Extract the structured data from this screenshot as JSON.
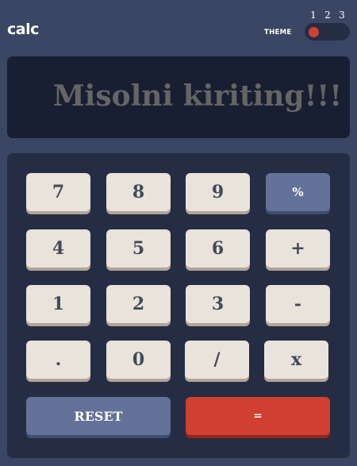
{
  "header": {
    "logo": "calc",
    "theme_label": "THEME",
    "theme_numbers": [
      "1",
      "2",
      "3"
    ]
  },
  "screen": {
    "value": "Misolni kiriting!!!"
  },
  "keys": {
    "row1": [
      "7",
      "8",
      "9",
      "%"
    ],
    "row2": [
      "4",
      "5",
      "6",
      "+"
    ],
    "row3": [
      "1",
      "2",
      "3",
      "-"
    ],
    "row4": [
      ".",
      "0",
      "/",
      "x"
    ],
    "reset": "RESET",
    "equals": "="
  },
  "colors": {
    "background": "#3a4664",
    "screen": "#181f32",
    "keypad": "#252d44",
    "key": "#eae3dc",
    "accent": "#647198",
    "equals": "#d03f2f"
  }
}
